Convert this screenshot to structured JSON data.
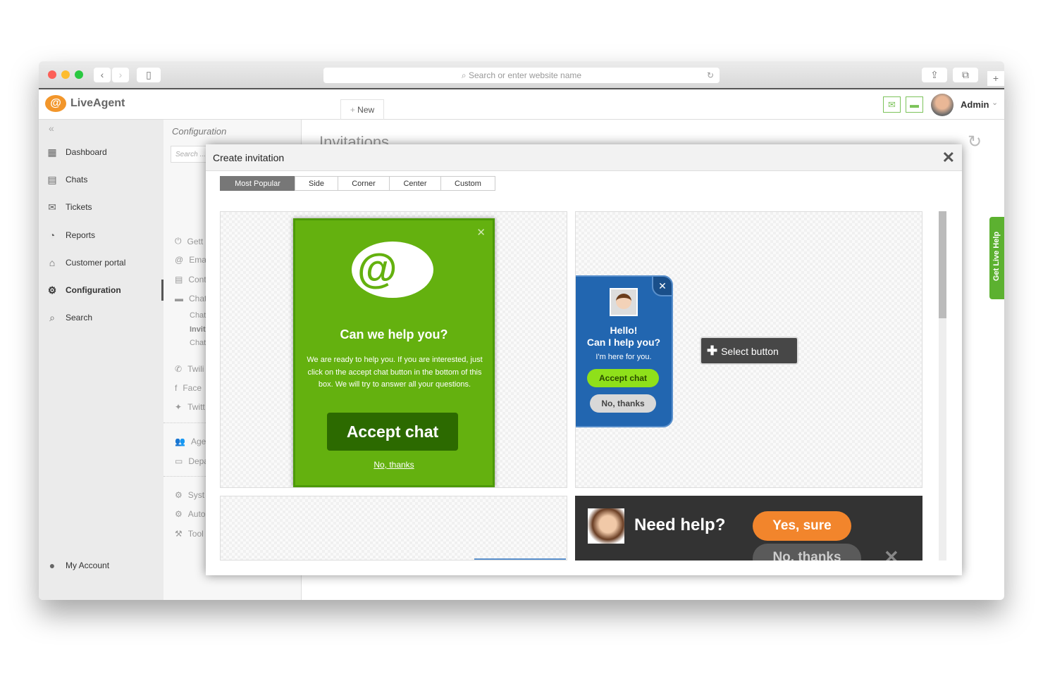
{
  "browser": {
    "url_placeholder": "Search or enter website name"
  },
  "app": {
    "logo": "LiveAgent",
    "new_label": "New",
    "user": "Admin"
  },
  "sidebar": {
    "items": [
      {
        "label": "Dashboard",
        "icon": "dashboard-icon"
      },
      {
        "label": "Chats",
        "icon": "chat-icon"
      },
      {
        "label": "Tickets",
        "icon": "envelope-icon"
      },
      {
        "label": "Reports",
        "icon": "pie-chart-icon"
      },
      {
        "label": "Customer portal",
        "icon": "building-icon"
      },
      {
        "label": "Configuration",
        "icon": "gear-icon",
        "active": true
      },
      {
        "label": "Search",
        "icon": "search-icon"
      }
    ],
    "account": "My Account"
  },
  "config": {
    "title": "Configuration",
    "search_placeholder": "Search ...",
    "items": [
      "Gett",
      "Ema",
      "Cont",
      "Chat",
      "Chat",
      "Invit",
      "Chat",
      "Twili",
      "Face",
      "Twitt",
      "Ager",
      "Depa",
      "Syst",
      "Auto",
      "Tool"
    ]
  },
  "main": {
    "title": "Invitations"
  },
  "get_live_help": "Get Live Help",
  "modal": {
    "title": "Create invitation",
    "tabs": [
      "Most Popular",
      "Side",
      "Corner",
      "Center",
      "Custom"
    ],
    "active_tab": "Most Popular",
    "green": {
      "heading": "Can we help you?",
      "body": "We are ready to help you. If you are interested, just click on the accept chat button in the bottom of this box. We will try to answer all your questions.",
      "accept": "Accept chat",
      "decline": "No, thanks",
      "color": "#64b10f"
    },
    "blue": {
      "line1": "Hello!",
      "line2": "Can I help you?",
      "sub": "I'm here for you.",
      "accept": "Accept chat",
      "decline": "No, thanks",
      "color": "#2266b0"
    },
    "select_button": "Select button",
    "dark": {
      "heading": "Need help?",
      "accept": "Yes, sure",
      "decline": "No, thanks",
      "accent": "#f2852c"
    }
  }
}
